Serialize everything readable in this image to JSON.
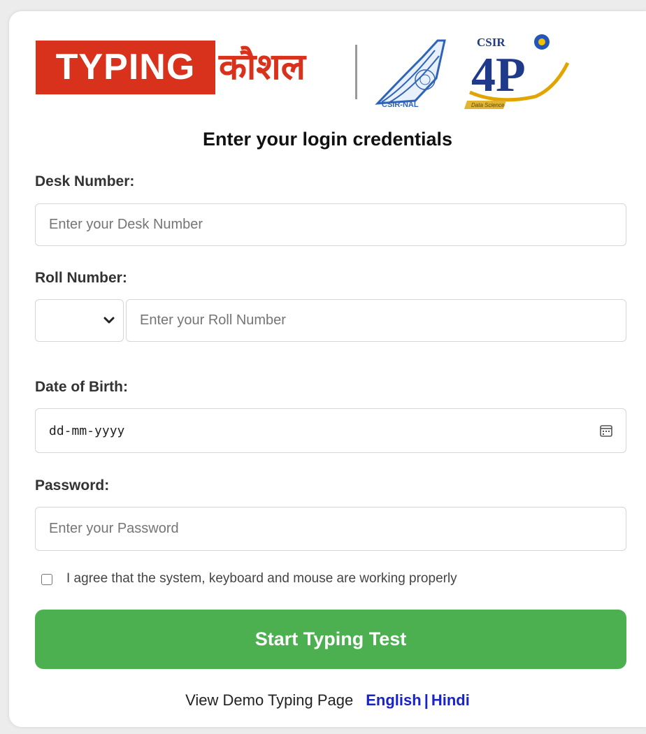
{
  "logo": {
    "typing_text": "TYPING",
    "hindi_text": "कौशल",
    "nal_text": "CSIR-NAL",
    "csir_text": "CSIR",
    "fourpi_text": "4P",
    "fourpi_tagline": "Data Science"
  },
  "form": {
    "heading": "Enter your login credentials",
    "desk": {
      "label": "Desk Number:",
      "placeholder": "Enter your Desk Number"
    },
    "roll": {
      "label": "Roll Number:",
      "prefix_value": "",
      "placeholder": "Enter your Roll Number"
    },
    "dob": {
      "label": "Date of Birth:",
      "value": "dd-mm-yyyy"
    },
    "password": {
      "label": "Password:",
      "placeholder": "Enter your Password"
    },
    "agree_label": "I agree that the system, keyboard and mouse are working properly",
    "start_button": "Start Typing Test"
  },
  "demo": {
    "label": "View Demo Typing Page",
    "english_link": "English",
    "separator": "|",
    "hindi_link": "Hindi"
  },
  "colors": {
    "brand_red": "#d9321c",
    "button_green": "#4caf50",
    "link_blue": "#1a23c8"
  }
}
